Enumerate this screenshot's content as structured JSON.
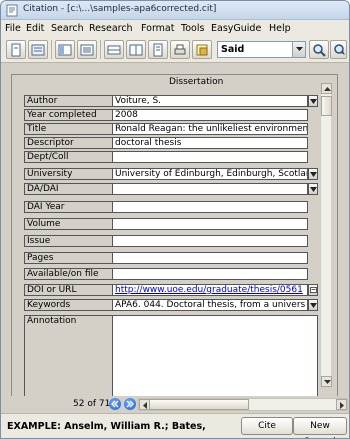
{
  "window": {
    "title": "Citation - [c:\\...\\samples-apa6corrected.cit]"
  },
  "menu": [
    "File",
    "Edit",
    "Search",
    "Research",
    "Format",
    "Tools",
    "EasyGuide",
    "Help"
  ],
  "toolbar": {
    "search_value": "Said"
  },
  "record": {
    "type_legend": "Dissertation",
    "fields": [
      {
        "label": "Author",
        "value": "Voiture, S."
      },
      {
        "label": "Year completed",
        "value": "2008"
      },
      {
        "label": "Title",
        "value": "Ronald Reagan: the unlikeliest environmentali"
      },
      {
        "label": "Descriptor",
        "value": "doctoral thesis"
      },
      {
        "label": "Dept/Coll",
        "value": ""
      },
      {
        "label": "University",
        "value": "University of Edinburgh, Edinburgh, Scotlan"
      },
      {
        "label": "DA/DAI",
        "value": ""
      },
      {
        "label": "DAI Year",
        "value": ""
      },
      {
        "label": "Volume",
        "value": ""
      },
      {
        "label": "Issue",
        "value": ""
      },
      {
        "label": "Pages",
        "value": ""
      },
      {
        "label": "Available/on file",
        "value": ""
      },
      {
        "label": "DOI or URL",
        "value": "http://www.uoe.edu/graduate/thesis/0561"
      },
      {
        "label": "Keywords",
        "value": "APA6. 044. Doctoral thesis, from a univers"
      },
      {
        "label": "Annotation",
        "value": ""
      }
    ]
  },
  "navigation": {
    "record_count": "52 of 71"
  },
  "status": {
    "text": "EXAMPLE: Anselm, William R.; Bates,",
    "cite_label": "Cite",
    "new_record_label": "New Record"
  }
}
